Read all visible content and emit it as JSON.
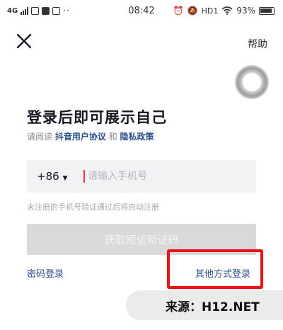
{
  "status_bar": {
    "network": "4G",
    "time": "08:42",
    "hd": "HD1",
    "battery": "93%"
  },
  "header": {
    "help_label": "帮助"
  },
  "main": {
    "title": "登录后即可展示自己",
    "agreement_prefix": "请阅读",
    "agreement_link1": "抖音用户协议",
    "agreement_and": "和",
    "agreement_link2": "隐私政策",
    "country_code": "+86",
    "phone_placeholder": "请输入手机号",
    "hint": "未注册的手机号验证通过后将自动注册",
    "sms_button": "获取短信验证码",
    "password_login": "密码登录",
    "other_login": "其他方式登录"
  },
  "watermark": {
    "text": "来源：H12.NET"
  },
  "colors": {
    "link": "#2b4f8c",
    "highlight": "#e8141a",
    "caret": "#fe2c55",
    "disabled_button": "#d9d9db"
  },
  "icons": [
    "signal-icon",
    "app-icon",
    "alarm-icon",
    "wifi-icon",
    "battery-icon",
    "close-icon",
    "loading-icon"
  ]
}
